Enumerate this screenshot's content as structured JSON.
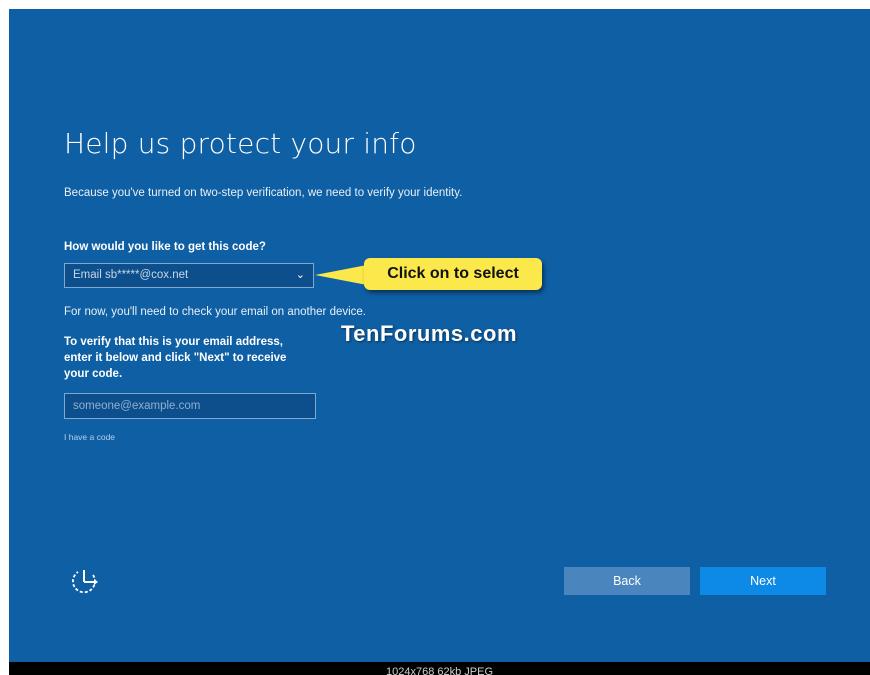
{
  "page": {
    "title": "Help us protect your info",
    "subtitle": "Because you've turned on two-step verification, we need to verify your identity.",
    "question": "How would you like to get this code?",
    "method_select": {
      "value": "Email sb*****@cox.net"
    },
    "note": "For now, you'll need to check your email on another device.",
    "verify_instructions": "To verify that this is your email address, enter it below and click \"Next\" to receive your code.",
    "email_input": {
      "placeholder": "someone@example.com",
      "value": ""
    },
    "have_code_link": "I have a code"
  },
  "annotation": {
    "callout_text": "Click on to select",
    "callout_color": "#fbe84a",
    "watermark": "TenForums.com"
  },
  "buttons": {
    "back_label": "Back",
    "next_label": "Next"
  },
  "footer": {
    "image_info": "1024x768 62kb JPEG"
  },
  "icons": {
    "accessibility": "ease-of-access-icon",
    "dropdown": "chevron-down-icon"
  },
  "colors": {
    "background": "#0f5fa5",
    "back_button": "#4a85bd",
    "next_button": "#0c8ae6"
  }
}
